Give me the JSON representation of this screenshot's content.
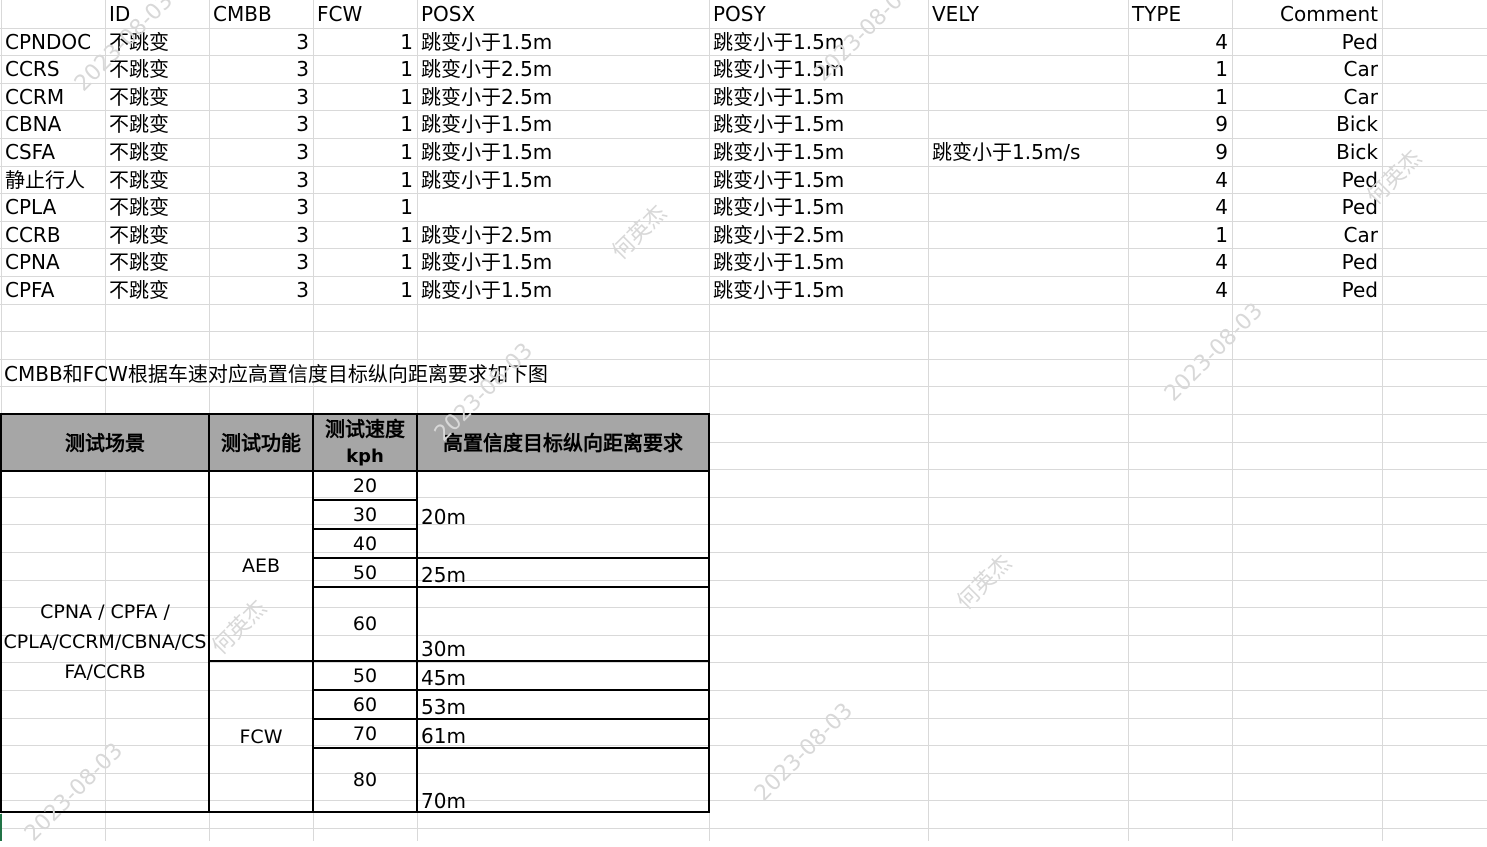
{
  "headers": [
    "",
    "ID",
    "CMBB",
    "FCW",
    "POSX",
    "POSY",
    "VELY",
    "TYPE",
    "Comment"
  ],
  "rows": [
    {
      "name": "CPNDOC",
      "id": "不跳变",
      "cmbb": "3",
      "fcw": "1",
      "posx": "跳变小于1.5m",
      "posy": "跳变小于1.5m",
      "vely": "",
      "type": "4",
      "comment": "Ped"
    },
    {
      "name": "CCRS",
      "id": "不跳变",
      "cmbb": "3",
      "fcw": "1",
      "posx": "跳变小于2.5m",
      "posy": "跳变小于1.5m",
      "vely": "",
      "type": "1",
      "comment": "Car"
    },
    {
      "name": "CCRM",
      "id": "不跳变",
      "cmbb": "3",
      "fcw": "1",
      "posx": "跳变小于2.5m",
      "posy": "跳变小于1.5m",
      "vely": "",
      "type": "1",
      "comment": "Car"
    },
    {
      "name": "CBNA",
      "id": "不跳变",
      "cmbb": "3",
      "fcw": "1",
      "posx": "跳变小于1.5m",
      "posy": "跳变小于1.5m",
      "vely": "",
      "type": "9",
      "comment": "Bick"
    },
    {
      "name": "CSFA",
      "id": "不跳变",
      "cmbb": "3",
      "fcw": "1",
      "posx": "跳变小于1.5m",
      "posy": "跳变小于1.5m",
      "vely": "跳变小于1.5m/s",
      "type": "9",
      "comment": "Bick"
    },
    {
      "name": "静止行人",
      "id": "不跳变",
      "cmbb": "3",
      "fcw": "1",
      "posx": "跳变小于1.5m",
      "posy": "跳变小于1.5m",
      "vely": "",
      "type": "4",
      "comment": "Ped"
    },
    {
      "name": "CPLA",
      "id": "不跳变",
      "cmbb": "3",
      "fcw": "1",
      "posx": "",
      "posy": "跳变小于1.5m",
      "vely": "",
      "type": "4",
      "comment": "Ped"
    },
    {
      "name": "CCRB",
      "id": "不跳变",
      "cmbb": "3",
      "fcw": "1",
      "posx": "跳变小于2.5m",
      "posy": "跳变小于2.5m",
      "vely": "",
      "type": "1",
      "comment": "Car"
    },
    {
      "name": "CPNA",
      "id": "不跳变",
      "cmbb": "3",
      "fcw": "1",
      "posx": "跳变小于1.5m",
      "posy": "跳变小于1.5m",
      "vely": "",
      "type": "4",
      "comment": "Ped"
    },
    {
      "name": "CPFA",
      "id": "不跳变",
      "cmbb": "3",
      "fcw": "1",
      "posx": "跳变小于1.5m",
      "posy": "跳变小于1.5m",
      "vely": "",
      "type": "4",
      "comment": "Ped"
    }
  ],
  "note": "CMBB和FCW根据车速对应高置信度目标纵向距离要求如下图",
  "req_table": {
    "headers": {
      "scene": "测试场景",
      "func": "测试功能",
      "speed_line1": "测试速度",
      "speed_line2": "kph",
      "distance": "高置信度目标纵向距离要求"
    },
    "scene_lines": [
      "CPNA / CPFA /",
      "CPLA/CCRM/CBNA/CS",
      "FA/CCRB"
    ],
    "aeb": {
      "label": "AEB",
      "speeds": [
        "20",
        "30",
        "40",
        "50",
        "60"
      ],
      "distances": [
        "20m",
        "25m",
        "30m"
      ]
    },
    "fcw": {
      "label": "FCW",
      "speeds": [
        "50",
        "60",
        "70",
        "80"
      ],
      "distances": [
        "45m",
        "53m",
        "61m",
        "70m"
      ]
    }
  },
  "watermark": {
    "name": "何英杰",
    "date": "2023-08-03"
  },
  "colors": {
    "header_fill": "#a6a6a6",
    "gridline": "#d9d9d9",
    "border": "#000000",
    "watermark": "#d8d8d8",
    "selection": "#217346"
  }
}
